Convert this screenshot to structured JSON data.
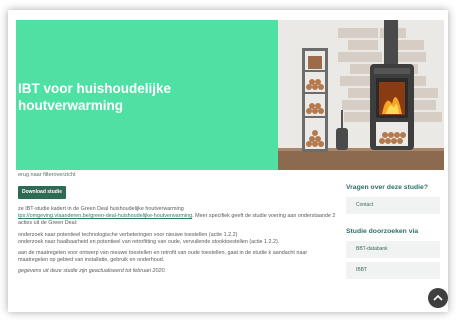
{
  "hero": {
    "title": "IBT voor huishoudelijke houtverwarming"
  },
  "back_link": "erug naar filteroverzicht",
  "download_button": "Download studie",
  "body": {
    "p1_prefix": "ze IBT-studie kadert in de Green Deal huishoudelijke houtverwarming",
    "p1_link": "tps://omgeving.vlaanderen.be/green-deal-huishoudelijke-houtverwarming",
    "p1_suffix": ". Meer specifiek geeft de studie voering aan onderstaande 2 acties uit de Green Deal:",
    "p2": "onderzoek naar potentieel technologische verbeteringen voor nieuwe toestellen (actie 1.2.2)",
    "p3": "onderzoek naar haalbaarheid en potentieel van retrofitting van oude, vervuilende stooktoestellen (actie 1.2.2).",
    "p4": "aan de maatregelen voor ontwerp van nieuwe toestellen en retrofit van oude toestellen, gaat in de studie k aandacht naar maatregelen op gebied van installatie, gebruik en onderhoud.",
    "note": "gegevens uit deze studie zijn geactualiseerd tot februari 2020."
  },
  "sidebar": {
    "questions_heading": "Vragen over deze studie?",
    "contact": "Contact",
    "search_heading": "Studie doorzoeken via",
    "links": [
      "BBT-databank",
      "IBBT"
    ]
  }
}
